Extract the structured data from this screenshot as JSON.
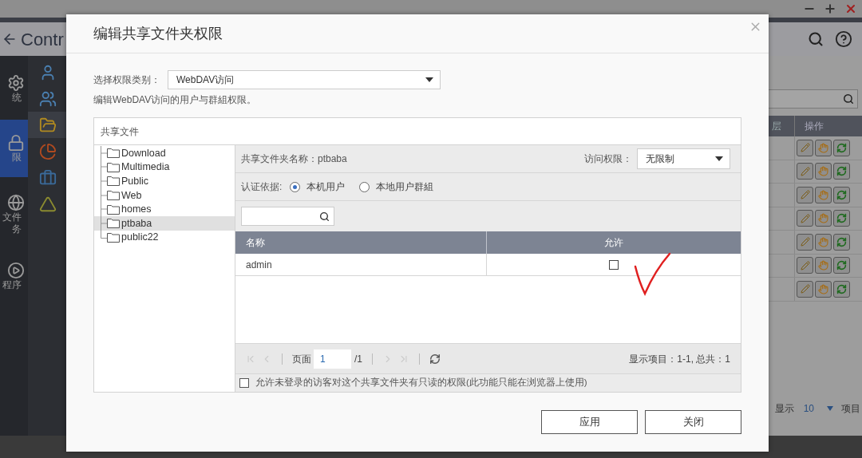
{
  "background": {
    "app_title": "Contr",
    "nav_items": [
      {
        "label_lines": [
          "统"
        ],
        "selected": false
      },
      {
        "label_lines": [
          "限"
        ],
        "selected": true
      },
      {
        "label_lines": [
          "文件",
          "务"
        ],
        "selected": false
      },
      {
        "label_lines": [
          "程序"
        ],
        "selected": false
      }
    ],
    "sub_items": [
      {
        "selected": false
      },
      {
        "selected": false
      },
      {
        "selected": true
      },
      {
        "selected": false
      },
      {
        "selected": false
      },
      {
        "selected": false
      }
    ],
    "table": {
      "columns": [
        "层",
        "操作"
      ],
      "rows": [
        {
          "kind": "actions"
        },
        {
          "kind": "actions"
        },
        {
          "kind": "actions"
        },
        {
          "kind": "actions"
        },
        {
          "kind": "actions"
        },
        {
          "kind": "actions"
        },
        {
          "kind": "actions"
        }
      ]
    },
    "footer": {
      "show_label": "显示",
      "page_size": "10",
      "items_label": "项目"
    }
  },
  "dialog": {
    "title": "编辑共享文件夹权限",
    "category_label": "选择权限类别：",
    "category_value": "WebDAV访问",
    "description": "编辑WebDAV访问的用户与群組权限。",
    "tree_header": "共享文件",
    "folders": [
      {
        "name": "Download",
        "selected": false
      },
      {
        "name": "Multimedia",
        "selected": false
      },
      {
        "name": "Public",
        "selected": false
      },
      {
        "name": "Web",
        "selected": false
      },
      {
        "name": "homes",
        "selected": false
      },
      {
        "name": "ptbaba",
        "selected": true
      },
      {
        "name": "public22",
        "selected": false
      }
    ],
    "folder_name": "共享文件夹名称：ptbaba",
    "access_label": "访问权限：",
    "access_value": "无限制",
    "auth_label": "认证依据:",
    "auth_options": [
      {
        "label": "本机用户",
        "selected": true
      },
      {
        "label": "本地用户群組",
        "selected": false
      }
    ],
    "table": {
      "columns": [
        "名称",
        "允许"
      ],
      "rows": [
        {
          "name": "admin",
          "allowed": false
        }
      ]
    },
    "pager": {
      "page_label": "页面",
      "page": "1",
      "total": "/1",
      "summary": "显示项目：1-1, 总共：1"
    },
    "guest_option": {
      "label": "允许未登录的访客对这个共享文件夹有只读的权限(此功能只能在浏览器上使用)",
      "checked": false
    },
    "buttons": [
      "应用",
      "关闭"
    ]
  }
}
